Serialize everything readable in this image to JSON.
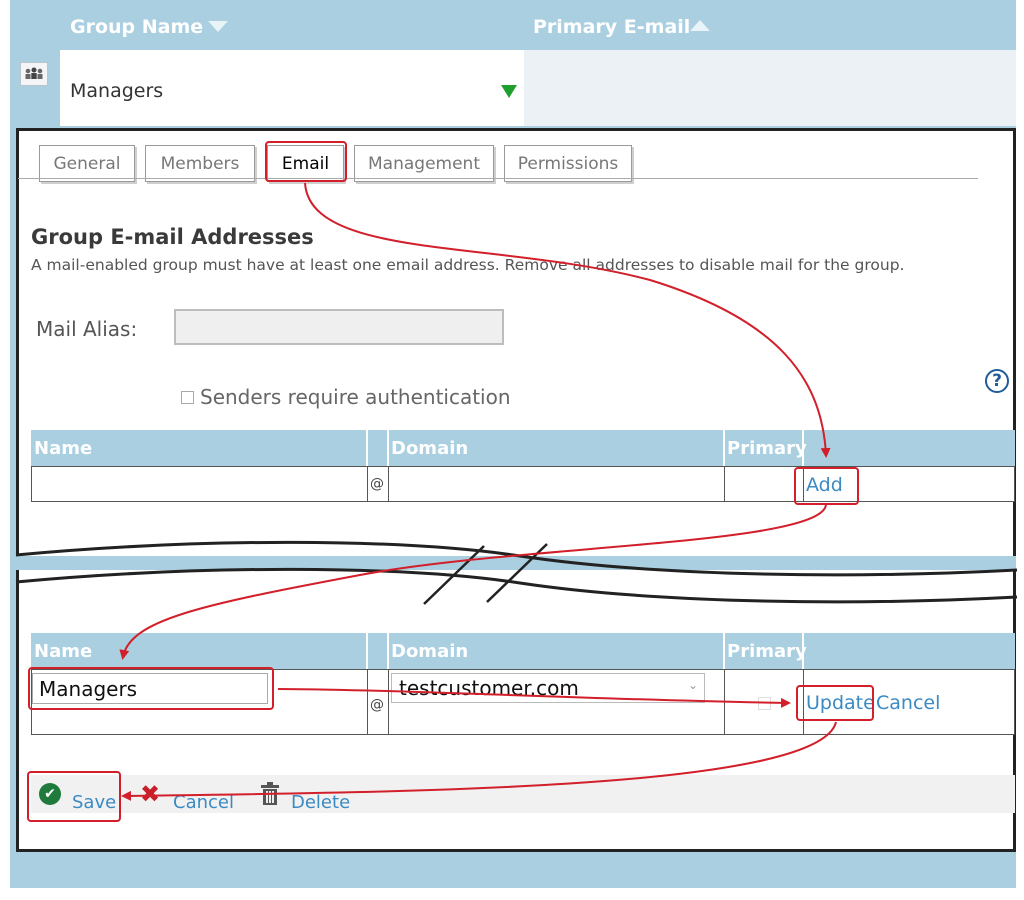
{
  "header": {
    "group_name_label": "Group Name",
    "primary_email_label": "Primary E-mail"
  },
  "group_row": {
    "name": "Managers",
    "group_icon": "group-users-icon",
    "expand_icon": "triangle-down-green-icon"
  },
  "tabs": [
    {
      "label": "General"
    },
    {
      "label": "Members"
    },
    {
      "label": "Email",
      "active": true
    },
    {
      "label": "Management"
    },
    {
      "label": "Permissions"
    }
  ],
  "email_section": {
    "title": "Group E-mail Addresses",
    "description": "A mail-enabled group must have at least one email address. Remove all addresses to disable mail for the group.",
    "mail_alias_label": "Mail Alias:",
    "mail_alias_value": "",
    "senders_auth_label": "Senders require authentication",
    "senders_auth_checked": false,
    "help_icon": "?"
  },
  "address_table": {
    "columns": [
      "Name",
      "",
      "Domain",
      "Primary",
      ""
    ],
    "at_symbol": "@",
    "add_label": "Add"
  },
  "edit_table": {
    "columns": [
      "Name",
      "",
      "Domain",
      "Primary",
      ""
    ],
    "name_value": "Managers",
    "at_symbol": "@",
    "domain_value": "testcustomer.com",
    "primary_checked": false,
    "update_label": "Update",
    "cancel_label": "Cancel"
  },
  "actions": {
    "save_label": "Save",
    "cancel_label": "Cancel",
    "delete_label": "Delete"
  },
  "colors": {
    "header_blue": "#a9cfe0",
    "link_blue": "#3a8ac4",
    "annotation_red": "#d21f2a",
    "save_green": "#1f7a3c"
  }
}
